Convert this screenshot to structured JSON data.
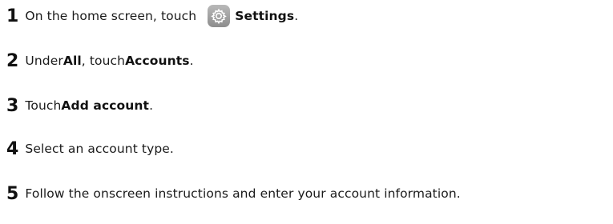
{
  "steps": [
    {
      "number": "1",
      "before": "On the home screen, touch",
      "icon": "settings-gear-icon",
      "bold1": "Settings",
      "after": "."
    },
    {
      "number": "2",
      "before": "Under ",
      "bold1": "All",
      "middle": ", touch ",
      "bold2": "Accounts",
      "after": "."
    },
    {
      "number": "3",
      "before": "Touch ",
      "bold1": "Add account",
      "after": "."
    },
    {
      "number": "4",
      "text": "Select an account type."
    },
    {
      "number": "5",
      "text": "Follow the onscreen instructions and enter your account information."
    }
  ]
}
